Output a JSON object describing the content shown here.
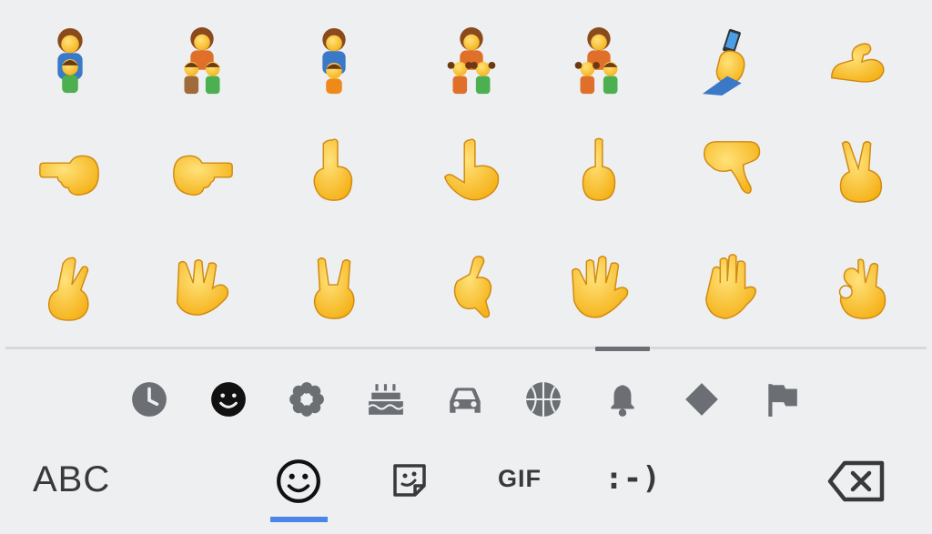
{
  "emoji_grid": {
    "rows": [
      [
        "family-woman-boy",
        "family-woman-boy-boy",
        "family-woman-girl-boy",
        "family-woman-girl-girl-boy",
        "family-woman-girl-girl-boy-2",
        "selfie",
        "flexed-biceps"
      ],
      [
        "pointing-left",
        "pointing-right",
        "index-pointing-up",
        "backhand-index-pointing-up",
        "middle-finger",
        "pointing-down",
        "victory-hand"
      ],
      [
        "crossed-fingers",
        "vulcan-salute",
        "sign-of-the-horns",
        "call-me-hand",
        "raised-hand-fingers-splayed",
        "raised-hand",
        "ok-hand"
      ]
    ]
  },
  "categories": [
    "recent-icon",
    "smileys-icon",
    "nature-icon",
    "food-icon",
    "travel-icon",
    "sports-icon",
    "objects-icon",
    "symbols-icon",
    "flags-icon"
  ],
  "selected_category": "smileys-icon",
  "bottom_bar": {
    "abc_label": "ABC",
    "gif_label": "GIF",
    "emoticon_label": ":-)",
    "active_tab": "emoji"
  },
  "colors": {
    "background": "#eeeff1",
    "icon_gray": "#6b6e73",
    "active_underline": "#4a86e8",
    "skin": "#fbc73a",
    "skin_outline": "#d08a10"
  }
}
